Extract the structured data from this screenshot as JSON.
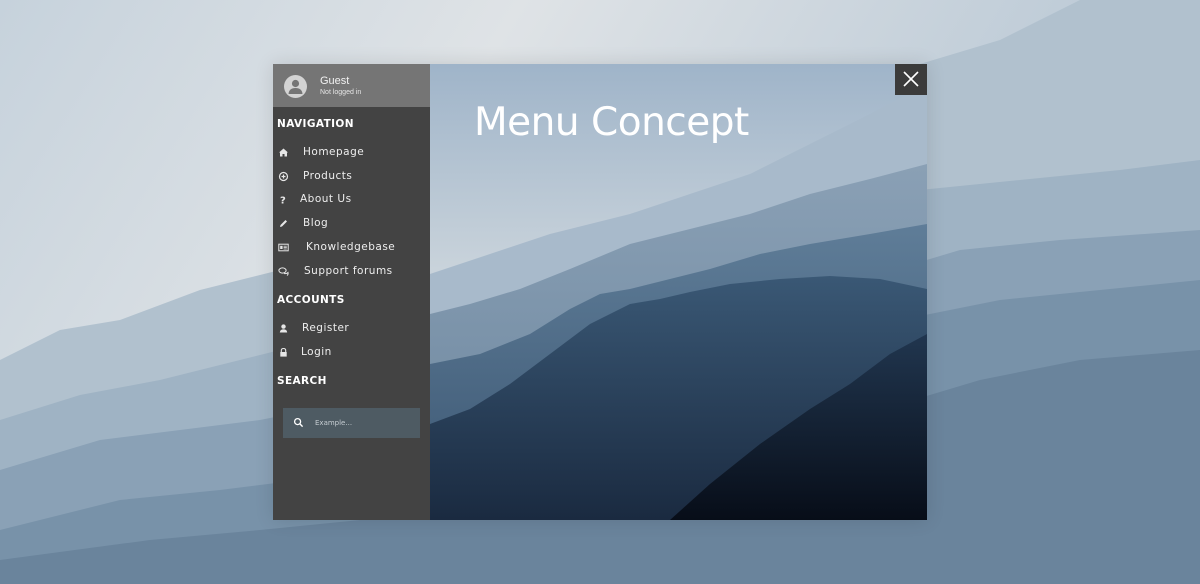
{
  "user": {
    "name": "Guest",
    "status": "Not logged in"
  },
  "hero": {
    "title": "Menu Concept"
  },
  "sections": {
    "navigation": "NAVIGATION",
    "accounts": "ACCOUNTS",
    "search": "SEARCH"
  },
  "navigation_items": [
    {
      "label": "Homepage",
      "icon": "home-icon"
    },
    {
      "label": "Products",
      "icon": "circle-plus-icon"
    },
    {
      "label": "About Us",
      "icon": "question-icon"
    },
    {
      "label": "Blog",
      "icon": "pencil-icon"
    },
    {
      "label": "Knowledgebase",
      "icon": "id-card-icon"
    },
    {
      "label": "Support forums",
      "icon": "chat-bubbles-icon"
    }
  ],
  "account_items": [
    {
      "label": "Register",
      "icon": "user-icon"
    },
    {
      "label": "Login",
      "icon": "lock-icon"
    }
  ],
  "search": {
    "placeholder": "Example...",
    "icon": "search-icon"
  },
  "colors": {
    "sidebar": "#434343",
    "user_header": "#757575",
    "search_box": "#4e5b63",
    "close_button": "#3b3b3b"
  }
}
